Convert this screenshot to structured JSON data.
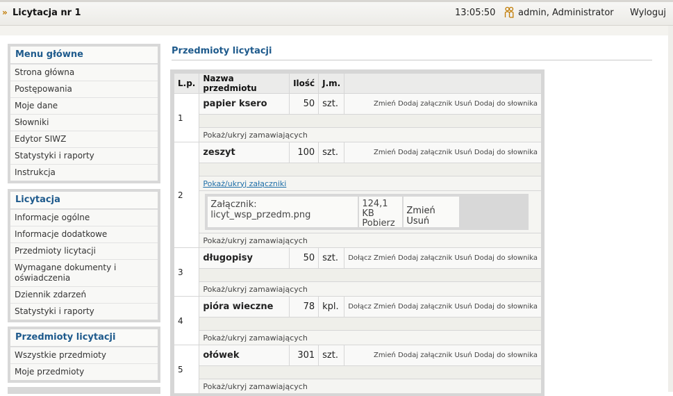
{
  "header": {
    "title": "Licytacja nr 1",
    "time": "13:05:50",
    "user": "admin, Administrator",
    "logout": "Wyloguj"
  },
  "menus": [
    {
      "title": "Menu główne",
      "items": [
        "Strona główna",
        "Postępowania",
        "Moje dane",
        "Słowniki",
        "Edytor SIWZ",
        "Statystyki i raporty",
        "Instrukcja"
      ]
    },
    {
      "title": "Licytacja",
      "items": [
        "Informacje ogólne",
        "Informacje dodatkowe",
        "Przedmioty licytacji",
        "Wymagane dokumenty i oświadczenia",
        "Dziennik zdarzeń",
        "Statystyki i raporty"
      ]
    },
    {
      "title": "Przedmioty licytacji",
      "items": [
        "Wszystkie przedmioty",
        "Moje przedmioty"
      ]
    }
  ],
  "main": {
    "title": "Przedmioty licytacji",
    "columns": [
      "L.p.",
      "Nazwa przedmiotu",
      "Ilość",
      "J.m."
    ],
    "toggle_orderers": "Pokaż/ukryj zamawiających",
    "toggle_attachments": "Pokaż/ukryj załączniki",
    "rows": [
      {
        "lp": "1",
        "name": "papier ksero",
        "qty": "50",
        "unit": "szt.",
        "actions": [
          "Zmień",
          "Dodaj załącznik",
          "Usuń",
          "Dodaj do słownika"
        ]
      },
      {
        "lp": "2",
        "name": "zeszyt",
        "qty": "100",
        "unit": "szt.",
        "actions": [
          "Zmień",
          "Dodaj załącznik",
          "Usuń",
          "Dodaj do słownika"
        ]
      },
      {
        "lp": "3",
        "name": "długopisy",
        "qty": "50",
        "unit": "szt.",
        "actions": [
          "Dołącz",
          "Zmień",
          "Dodaj załącznik",
          "Usuń",
          "Dodaj do słownika"
        ]
      },
      {
        "lp": "4",
        "name": "pióra wieczne",
        "qty": "78",
        "unit": "kpl.",
        "actions": [
          "Dołącz",
          "Zmień",
          "Dodaj załącznik",
          "Usuń",
          "Dodaj do słownika"
        ]
      },
      {
        "lp": "5",
        "name": "ołówek",
        "qty": "301",
        "unit": "szt.",
        "actions": [
          "Zmień",
          "Dodaj załącznik",
          "Usuń",
          "Dodaj do słownika"
        ]
      }
    ],
    "attachment": {
      "label": "Załącznik: licyt_wsp_przedm.png",
      "size": "124,1 KB",
      "download": "Pobierz",
      "change": "Zmień",
      "delete": "Usuń"
    }
  }
}
